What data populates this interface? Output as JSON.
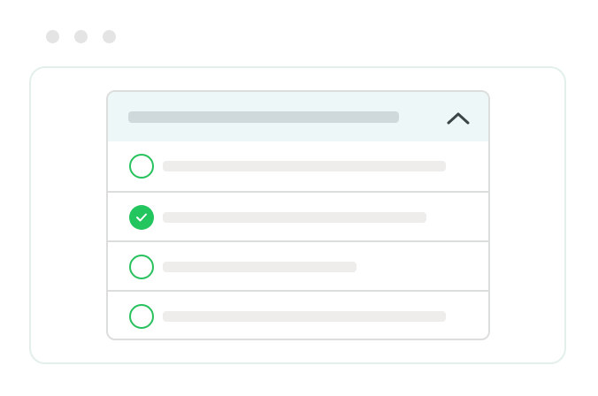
{
  "window": {
    "dots": [
      "dot-1",
      "dot-2",
      "dot-3"
    ]
  },
  "colors": {
    "accent": "#22c55e",
    "header_bg": "#eef7f7",
    "header_bar": "#cfd9dc",
    "placeholder_line": "#eeedec",
    "border": "#dcdedd"
  },
  "dropdown": {
    "expanded": true,
    "header_icon": "chevron-up-icon",
    "options": [
      {
        "selected": false
      },
      {
        "selected": true
      },
      {
        "selected": false
      },
      {
        "selected": false
      }
    ]
  }
}
